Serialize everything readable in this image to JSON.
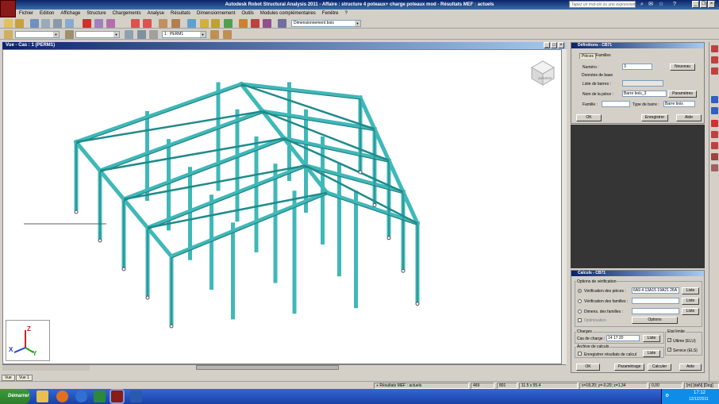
{
  "window": {
    "title": "Autodesk Robot Structural Analysis 2011 - Affaire : structure 4 poteaux+ charge poteaux mod - Résultats MEF : actuels",
    "search_placeholder": "Tapez un mot-clé ou une expression"
  },
  "menu": [
    "Fichier",
    "Edition",
    "Affichage",
    "Structure",
    "Chargements",
    "Analyse",
    "Résultats",
    "Dimensionnement",
    "Outils",
    "Modules complémentaires",
    "Fenêtre",
    "?"
  ],
  "toolbar": {
    "design_combo": "Dimensionnement bois",
    "case_combo": "1 : PERM1"
  },
  "view": {
    "title": "Vue - Cas : 1 (PERM1)",
    "cube_label": "ARRIÈRE",
    "axes": {
      "z": "Z",
      "x": "X",
      "y": "Y"
    }
  },
  "definitions": {
    "title": "Définitions - CB71",
    "tabs": [
      "Pièces",
      "Familles"
    ],
    "numero_label": "Numéro :",
    "numero_value": "3",
    "new_button": "Nouveau",
    "base_data_label": "Données de base",
    "bar_list_label": "Liste de barres :",
    "bar_list_value": "",
    "piece_name_label": "Nom de la pièce :",
    "piece_name_value": "Barre bois_3",
    "params_button": "Paramètres",
    "family_label": "Famille :",
    "family_value": "",
    "bar_type_label": "Type de barre :",
    "bar_type_value": "Barre bois",
    "ok": "OK",
    "save": "Enregistrer",
    "help": "Aide"
  },
  "calculs": {
    "title": "Calculs - CB71",
    "options_label": "Options de vérification",
    "verif_pieces_label": "Vérification des pièces :",
    "verif_pieces_value": "6A9 4 13A15 19A21 26A",
    "verif_familles_label": "Vérification des familles :",
    "dimens_label": "Dimens. des familles :",
    "optim_label": "Optimisation",
    "list_button": "Liste",
    "options_button": "Options",
    "charges_label": "Charges",
    "cases_label": "Cas de charge :",
    "cases_value": "14 17 20",
    "limit_label": "Etat limite",
    "ultimate_label": "Ultime (ELU)",
    "service_label": "Service (ELS)",
    "archive_label": "Archive de calculs",
    "save_results_label": "Enregistrer résultats de calcul",
    "ok": "OK",
    "params": "Paramétrage",
    "calc": "Calculer",
    "help": "Aide"
  },
  "view_tabs": [
    "Vue",
    "Vue 1"
  ],
  "status": {
    "results": "Résultats MEF : actuels",
    "num1": "469",
    "num2": "801",
    "section": "11.5 x 55.4",
    "coords": "x=18,20; y=-0,20; z=1,34",
    "value": "0,00",
    "units": "[m] [daN] [Deg]"
  },
  "taskbar": {
    "start": "Démarrer",
    "time": "17:12",
    "date": "12/12/2011"
  },
  "colors": {
    "structure": "#3fb8b8",
    "structure_dark": "#1f7a7a",
    "title_blue": "#0a246a"
  }
}
